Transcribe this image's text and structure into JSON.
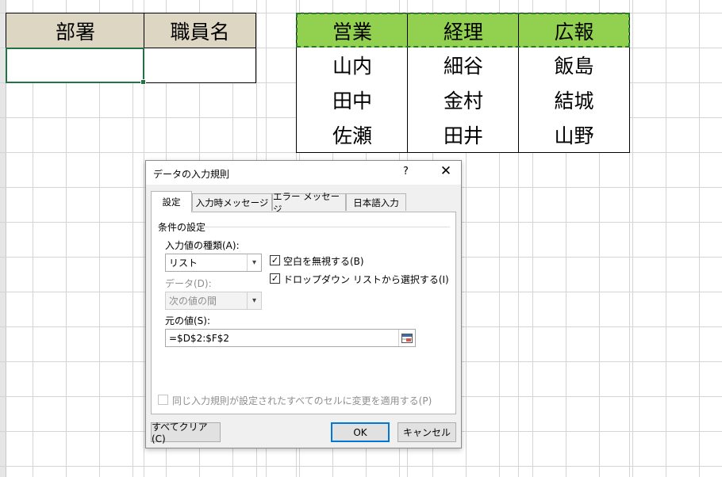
{
  "sheet": {
    "table1": {
      "headers": [
        "部署",
        "職員名"
      ]
    },
    "table2": {
      "headers": [
        "営業",
        "経理",
        "広報"
      ],
      "rows": [
        [
          "山内",
          "細谷",
          "飯島"
        ],
        [
          "田中",
          "金村",
          "結城"
        ],
        [
          "佐瀬",
          "田井",
          "山野"
        ]
      ]
    }
  },
  "dialog": {
    "title": "データの入力規則",
    "help": "?",
    "close": "✕",
    "tabs": [
      "設定",
      "入力時メッセージ",
      "エラー メッセージ",
      "日本語入力"
    ],
    "group_label": "条件の設定",
    "type_label": "入力値の種類(A):",
    "type_value": "リスト",
    "data_label": "データ(D):",
    "data_value": "次の値の間",
    "ignore_blank": "空白を無視する(B)",
    "dropdown": "ドロップダウン リストから選択する(I)",
    "source_label": "元の値(S):",
    "source_value": "=$D$2:$F$2",
    "apply_all": "同じ入力規則が設定されたすべてのセルに変更を適用する(P)",
    "clear_all": "すべてクリア(C)",
    "ok": "OK",
    "cancel": "キャンセル"
  }
}
